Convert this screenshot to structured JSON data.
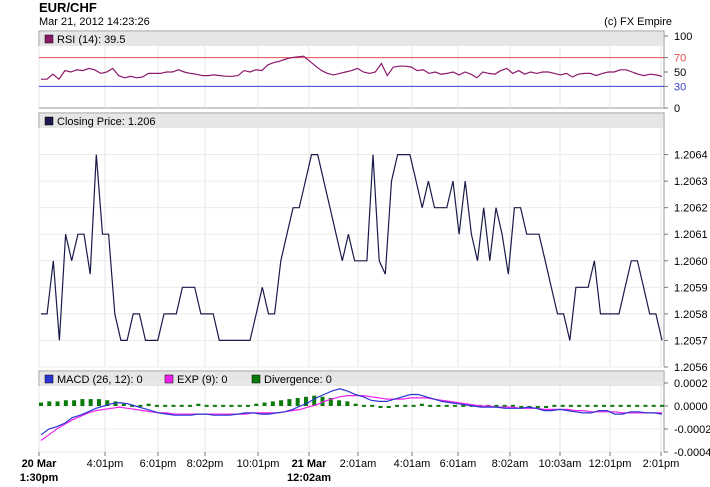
{
  "header": {
    "symbol": "EUR/CHF",
    "timestamp": "Mar 21, 2012 14:23:26",
    "copyright": "(c) FX Empire"
  },
  "colors": {
    "price": "#1a1a4a",
    "rsi": "#8b1a6b",
    "rsi_70": "#e05050",
    "rsi_30": "#4040d0",
    "macd": "#2a35d0",
    "exp": "#ee22ee",
    "divergence": "#0a7a0a",
    "panel_header": "#e6e6e6",
    "grid": "#cccccc"
  },
  "chart_data": [
    {
      "type": "line",
      "panel": "rsi",
      "legend": "RSI (14): 39.5",
      "ylim": [
        0,
        100
      ],
      "yticks": [
        "100",
        "70",
        "50",
        "30",
        "0"
      ],
      "ytick_values": [
        100,
        70,
        50,
        30,
        0
      ],
      "reference_lines": [
        70,
        30
      ],
      "values": [
        40,
        40,
        47,
        40,
        52,
        50,
        53,
        52,
        55,
        53,
        48,
        50,
        55,
        45,
        42,
        44,
        42,
        43,
        48,
        48,
        48,
        50,
        50,
        53,
        50,
        48,
        47,
        45,
        45,
        46,
        45,
        44,
        44,
        45,
        52,
        50,
        53,
        52,
        60,
        63,
        65,
        68,
        70,
        71,
        72,
        65,
        58,
        52,
        48,
        46,
        48,
        50,
        52,
        55,
        50,
        48,
        50,
        62,
        45,
        57,
        58,
        58,
        57,
        52,
        53,
        48,
        50,
        47,
        48,
        50,
        46,
        50,
        47,
        42,
        50,
        48,
        47,
        52,
        55,
        48,
        52,
        47,
        50,
        48,
        50,
        50,
        48,
        46,
        48,
        43,
        47,
        48,
        48,
        45,
        48,
        50,
        50,
        53,
        53,
        50,
        47,
        45,
        47,
        46,
        44
      ]
    },
    {
      "type": "line",
      "panel": "price",
      "legend": "Closing Price: 1.206",
      "ylim": [
        1.2056,
        1.2065
      ],
      "yticks": [
        "1.2064",
        "1.2063",
        "1.2062",
        "1.2061",
        "1.2060",
        "1.2059",
        "1.2058",
        "1.2057",
        "1.2056"
      ],
      "ytick_values": [
        1.2064,
        1.2063,
        1.2062,
        1.2061,
        1.206,
        1.2059,
        1.2058,
        1.2057,
        1.2056
      ],
      "values": [
        1.2058,
        1.2058,
        1.206,
        1.2057,
        1.2061,
        1.206,
        1.2061,
        1.2061,
        1.20595,
        1.2064,
        1.2061,
        1.2061,
        1.2058,
        1.2057,
        1.2057,
        1.2058,
        1.2058,
        1.2057,
        1.2057,
        1.2057,
        1.2058,
        1.2058,
        1.2058,
        1.2059,
        1.2059,
        1.2059,
        1.2058,
        1.2058,
        1.2058,
        1.2057,
        1.2057,
        1.2057,
        1.2057,
        1.2057,
        1.2057,
        1.2058,
        1.2059,
        1.2058,
        1.2058,
        1.206,
        1.2061,
        1.2062,
        1.2062,
        1.2063,
        1.2064,
        1.2064,
        1.2063,
        1.2062,
        1.2061,
        1.206,
        1.2061,
        1.206,
        1.206,
        1.206,
        1.2064,
        1.206,
        1.20595,
        1.2063,
        1.2064,
        1.2064,
        1.2064,
        1.2063,
        1.2062,
        1.2063,
        1.2062,
        1.2062,
        1.2062,
        1.2063,
        1.2061,
        1.2063,
        1.2061,
        1.206,
        1.2062,
        1.206,
        1.2062,
        1.2061,
        1.20595,
        1.2062,
        1.2062,
        1.2061,
        1.2061,
        1.2061,
        1.206,
        1.2059,
        1.2058,
        1.2058,
        1.2057,
        1.2059,
        1.2059,
        1.2059,
        1.206,
        1.2058,
        1.2058,
        1.2058,
        1.2058,
        1.2059,
        1.206,
        1.206,
        1.2059,
        1.2058,
        1.2058,
        1.2057
      ]
    },
    {
      "type": "line",
      "panel": "macd",
      "ylim": [
        -0.0004,
        0.0002
      ],
      "yticks": [
        "0.0002",
        "0.0000",
        "-0.0002",
        "-0.0004"
      ],
      "ytick_values": [
        0.0002,
        0.0,
        -0.0002,
        -0.0004
      ],
      "legend": [
        {
          "label": "MACD (26, 12): 0",
          "color_key": "macd"
        },
        {
          "label": "EXP (9): 0",
          "color_key": "exp"
        },
        {
          "label": "Divergence: 0",
          "color_key": "divergence"
        }
      ],
      "series": [
        {
          "name": "MACD (26, 12): 0",
          "color_key": "macd",
          "values": [
            -0.00025,
            -0.0002,
            -0.00018,
            -0.00015,
            -0.0001,
            -8e-05,
            -5e-05,
            -2e-05,
            0.0,
            2e-05,
            3e-05,
            2e-05,
            0.0,
            -2e-05,
            -4e-05,
            -6e-05,
            -7e-05,
            -8e-05,
            -8e-05,
            -8e-05,
            -7e-05,
            -7e-05,
            -8e-05,
            -8e-05,
            -8e-05,
            -7e-05,
            -6e-05,
            -6e-05,
            -7e-05,
            -7e-05,
            -6e-05,
            -5e-05,
            -3e-05,
            0.0,
            3e-05,
            7e-05,
            0.0001,
            0.00013,
            0.00015,
            0.00013,
            0.0001,
            8e-05,
            5e-05,
            4e-05,
            4e-05,
            6e-05,
            8e-05,
            0.0001,
            0.0001,
            8e-05,
            6e-05,
            4e-05,
            3e-05,
            2e-05,
            1e-05,
            0.0,
            -1e-05,
            -1e-05,
            -1e-05,
            -2e-05,
            -2e-05,
            -2e-05,
            -1e-05,
            -2e-05,
            -4e-05,
            -4e-05,
            -3e-05,
            -4e-05,
            -5e-05,
            -6e-05,
            -6e-05,
            -4e-05,
            -4e-05,
            -7e-05,
            -7e-05,
            -5e-05,
            -5e-05,
            -6e-05,
            -6e-05,
            -7e-05
          ]
        },
        {
          "name": "EXP (9): 0",
          "color_key": "exp",
          "values": [
            -0.0003,
            -0.00025,
            -0.0002,
            -0.00016,
            -0.00012,
            -9e-05,
            -6e-05,
            -4e-05,
            -3e-05,
            -2e-05,
            -1e-05,
            -2e-05,
            -3e-05,
            -4e-05,
            -5e-05,
            -6e-05,
            -6e-05,
            -7e-05,
            -7e-05,
            -7e-05,
            -7e-05,
            -7e-05,
            -7e-05,
            -7e-05,
            -7e-05,
            -7e-05,
            -7e-05,
            -6e-05,
            -6e-05,
            -6e-05,
            -6e-05,
            -5e-05,
            -4e-05,
            -3e-05,
            -1e-05,
            1e-05,
            4e-05,
            6e-05,
            8e-05,
            9e-05,
            9e-05,
            9e-05,
            8e-05,
            7e-05,
            6e-05,
            6e-05,
            6e-05,
            7e-05,
            7e-05,
            7e-05,
            6e-05,
            5e-05,
            4e-05,
            3e-05,
            2e-05,
            1e-05,
            0.0,
            0.0,
            -1e-05,
            -1e-05,
            -1e-05,
            -2e-05,
            -2e-05,
            -2e-05,
            -3e-05,
            -3e-05,
            -3e-05,
            -3e-05,
            -4e-05,
            -4e-05,
            -5e-05,
            -5e-05,
            -5e-05,
            -5e-05,
            -6e-05,
            -6e-05,
            -6e-05,
            -6e-05,
            -6e-05,
            -6e-05
          ]
        },
        {
          "name": "Divergence: 0",
          "color_key": "divergence",
          "style": "bars",
          "values": [
            3e-05,
            4e-05,
            4e-05,
            5e-05,
            5e-05,
            6e-05,
            6e-05,
            6e-05,
            5e-05,
            4e-05,
            2e-05,
            1e-05,
            1e-05,
            2e-05,
            1e-05,
            1e-05,
            1e-05,
            1e-05,
            1e-05,
            2e-05,
            1e-05,
            1e-05,
            1e-05,
            1e-05,
            1e-05,
            1e-05,
            2e-05,
            3e-05,
            4e-05,
            5e-05,
            6e-05,
            7e-05,
            8e-05,
            9e-05,
            8e-05,
            7e-05,
            5e-05,
            4e-05,
            2e-05,
            1e-05,
            1e-05,
            -1e-05,
            -1e-05,
            1e-05,
            1e-05,
            1e-05,
            2e-05,
            1e-05,
            1e-05,
            1e-05,
            1e-05,
            1e-05,
            1e-05,
            1e-05,
            1e-05,
            1e-05,
            1e-05,
            1e-05,
            -1e-05,
            -1e-05,
            -1e-05,
            -1e-05,
            1e-05,
            1e-05,
            1e-05,
            1e-05,
            1e-05,
            1e-05,
            1e-05,
            1e-05,
            1e-05,
            1e-05,
            1e-05,
            1e-05,
            1e-05,
            1e-05
          ]
        }
      ]
    }
  ],
  "x_axis": {
    "labels": [
      {
        "text": "20 Mar",
        "sub": "1:30pm",
        "bold": true
      },
      {
        "text": "4:01pm"
      },
      {
        "text": "6:01pm"
      },
      {
        "text": "8:02pm"
      },
      {
        "text": "10:01pm"
      },
      {
        "text": "21 Mar",
        "sub": "12:02am",
        "bold": true
      },
      {
        "text": "2:01am"
      },
      {
        "text": "4:01am"
      },
      {
        "text": "6:01am"
      },
      {
        "text": "8:02am"
      },
      {
        "text": "10:03am"
      },
      {
        "text": "12:01pm"
      },
      {
        "text": "2:01pm"
      }
    ]
  }
}
